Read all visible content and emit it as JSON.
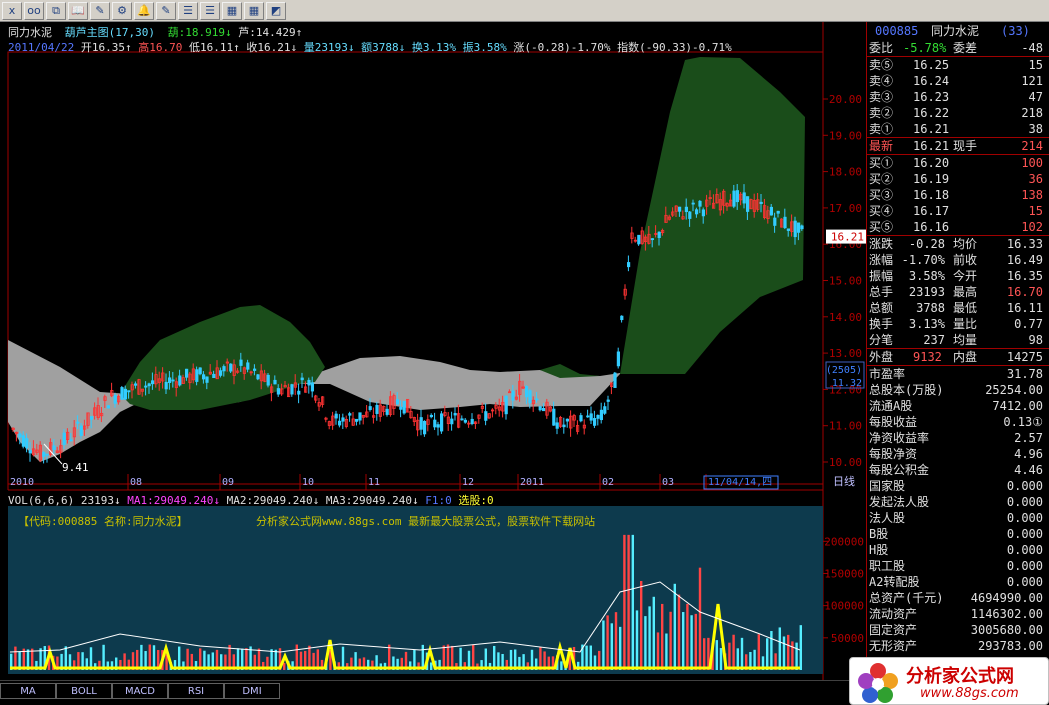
{
  "toolbar": {
    "buttons": [
      "x",
      "oo",
      "⧉",
      "📖",
      "✎",
      "⚙",
      "🔔",
      "✎",
      "☰",
      "☰",
      "▦",
      "▦",
      "◩"
    ]
  },
  "header": {
    "name": "同力水泥",
    "indicator": "葫芦主图(17,30)",
    "hu_label": "葫:18.919↓",
    "lu_label": "芦:14.429↑",
    "date": "2011/04/22",
    "open": "开16.35↑",
    "high": "高16.70",
    "low": "低16.11↑",
    "close": "收16.21↓",
    "volume": "量23193↓",
    "amount": "额3788↓",
    "turnover": "换3.13%",
    "amplitude": "振3.58%",
    "change": "涨(-0.28)-1.70%",
    "index": "指数(-90.33)-0.71%"
  },
  "price_axis": [
    "20.00",
    "19.00",
    "18.00",
    "17.00",
    "16.00",
    "15.00",
    "14.00",
    "13.00",
    "12.00",
    "11.00",
    "10.00"
  ],
  "current_price_tag": "16.21",
  "low_marker": "9.41",
  "side_tags": [
    "(2505)",
    "11.32"
  ],
  "x_axis": [
    "2010",
    "08",
    "09",
    "10",
    "11",
    "12",
    "2011",
    "02",
    "03",
    "11/04/14,四"
  ],
  "period_label": "日线",
  "vol_header": {
    "vol": "VOL(6,6,6)",
    "v": "23193↓",
    "ma1": "MA1:29049.240↓",
    "ma2": "MA2:29049.240↓",
    "ma3": "MA3:29049.240↓",
    "f1": "F1:0",
    "pick": "选股:0"
  },
  "vol_banner_left": "【代码:000885 名称:同力水泥】",
  "vol_banner_right": "分析家公式网www.88gs.com 最新最大股票公式，股票软件下载网站",
  "vol_axis": [
    "200000",
    "150000",
    "100000",
    "50000"
  ],
  "tabs": [
    "MA",
    "BOLL",
    "MACD",
    "RSI",
    "DMI"
  ],
  "side": {
    "code": "000885",
    "name": "同力水泥",
    "rank": "(33)",
    "weibi_label": "委比",
    "weibi_value": "-5.78%",
    "weicha_label": "委差",
    "weicha_value": "-48",
    "sells": [
      {
        "label": "卖⑤",
        "price": "16.25",
        "vol": "15"
      },
      {
        "label": "卖④",
        "price": "16.24",
        "vol": "121"
      },
      {
        "label": "卖③",
        "price": "16.23",
        "vol": "47"
      },
      {
        "label": "卖②",
        "price": "16.22",
        "vol": "218"
      },
      {
        "label": "卖①",
        "price": "16.21",
        "vol": "38"
      }
    ],
    "latest_label": "最新",
    "latest_value": "16.21",
    "xianshou_label": "现手",
    "xianshou_value": "214",
    "buys": [
      {
        "label": "买①",
        "price": "16.20",
        "vol": "100"
      },
      {
        "label": "买②",
        "price": "16.19",
        "vol": "36"
      },
      {
        "label": "买③",
        "price": "16.18",
        "vol": "138"
      },
      {
        "label": "买④",
        "price": "16.17",
        "vol": "15"
      },
      {
        "label": "买⑤",
        "price": "16.16",
        "vol": "102"
      }
    ],
    "stats": [
      {
        "l1": "涨跌",
        "v1": "-0.28",
        "l2": "均价",
        "v2": "16.33"
      },
      {
        "l1": "涨幅",
        "v1": "-1.70%",
        "l2": "前收",
        "v2": "16.49"
      },
      {
        "l1": "振幅",
        "v1": "3.58%",
        "l2": "今开",
        "v2": "16.35"
      },
      {
        "l1": "总手",
        "v1": "23193",
        "l2": "最高",
        "v2": "16.70"
      },
      {
        "l1": "总额",
        "v1": "3788",
        "l2": "最低",
        "v2": "16.11"
      },
      {
        "l1": "换手",
        "v1": "3.13%",
        "l2": "量比",
        "v2": "0.77"
      },
      {
        "l1": "分笔",
        "v1": "237",
        "l2": "均量",
        "v2": "98"
      }
    ],
    "waipan_label": "外盘",
    "waipan_value": "9132",
    "neipan_label": "内盘",
    "neipan_value": "14275",
    "fundamentals": [
      {
        "label": "市盈率",
        "value": "31.78"
      },
      {
        "label": "总股本(万股)",
        "value": "25254.00"
      },
      {
        "label": "流通A股",
        "value": "7412.00"
      },
      {
        "label": "每股收益",
        "value": "0.13①"
      },
      {
        "label": "净资收益率",
        "value": "2.57"
      },
      {
        "label": "每股净资",
        "value": "4.96"
      },
      {
        "label": "每股公积金",
        "value": "4.46"
      },
      {
        "label": "国家股",
        "value": "0.000"
      },
      {
        "label": "发起法人股",
        "value": "0.000"
      },
      {
        "label": "法人股",
        "value": "0.000"
      },
      {
        "label": "B股",
        "value": "0.000"
      },
      {
        "label": "H股",
        "value": "0.000"
      },
      {
        "label": "职工股",
        "value": "0.000"
      },
      {
        "label": "A2转配股",
        "value": "0.000"
      },
      {
        "label": "总资产(千元)",
        "value": "4694990.00"
      },
      {
        "label": "流动资产",
        "value": "1146302.00"
      },
      {
        "label": "固定资产",
        "value": "3005680.00"
      },
      {
        "label": "无形资产",
        "value": "293783.00"
      }
    ]
  },
  "logo": {
    "title": "分析家公式网",
    "url": "www.88gs.com"
  },
  "colors": {
    "up": "#ff3333",
    "down": "#33ccff",
    "hu": "#1a4d1a",
    "lu": "#a0a0a0",
    "vol_bg": "#0d3a4d"
  }
}
